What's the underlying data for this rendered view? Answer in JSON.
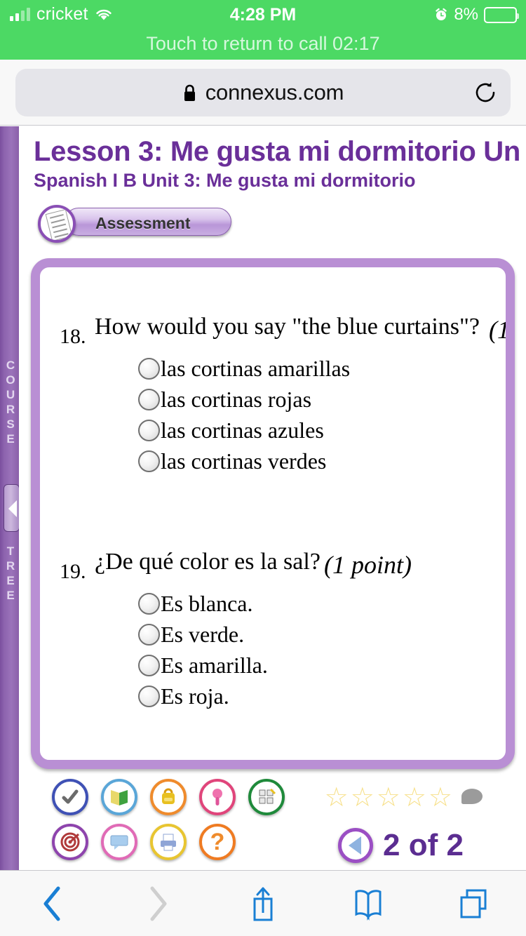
{
  "status_bar": {
    "carrier": "cricket",
    "time": "4:28 PM",
    "battery_percent": "8%",
    "call_banner": "Touch to return to call 02:17",
    "signal_icon": "signal-bars-icon",
    "wifi_icon": "wifi-icon",
    "alarm_icon": "alarm-clock-icon",
    "battery_icon": "battery-icon",
    "colors": {
      "background": "#4CD964",
      "text": "#FFFFFF",
      "banner_text": "#D6F8DE"
    }
  },
  "browser": {
    "url": "connexus.com",
    "lock_icon": "lock-icon",
    "reload_icon": "reload-icon",
    "bottom_toolbar": {
      "back_icon": "back-chevron-icon",
      "forward_icon": "forward-chevron-icon",
      "share_icon": "share-icon",
      "bookmarks_icon": "book-icon",
      "tabs_icon": "tabs-icon"
    }
  },
  "sidebar": {
    "label_top": "COURSE",
    "label_bottom": "TREE",
    "collapse_icon": "collapse-left-arrow-icon"
  },
  "page": {
    "lesson_title": "Lesson 3: Me gusta mi dormitorio Un",
    "lesson_subtitle": "Spanish I B  Unit 3: Me gusta mi dormitorio",
    "badge_label": "Assessment",
    "badge_icon": "document-icon",
    "accent_color": "#6A2F99",
    "card_border_color": "#B98FD4"
  },
  "questions": [
    {
      "number": "18.",
      "text": "How would you say \"the blue curtains\"?",
      "points": "(1",
      "options": [
        "las cortinas amarillas",
        "las cortinas rojas",
        "las cortinas azules",
        "las cortinas verdes"
      ]
    },
    {
      "number": "19.",
      "text": "¿De qué color es la sal?",
      "points": "(1 point)",
      "options": [
        "Es blanca.",
        "Es verde.",
        "Es amarilla.",
        "Es roja."
      ]
    }
  ],
  "tools": {
    "row1": [
      {
        "name": "checkmark-icon",
        "glyph": "✔",
        "ring": "#3f51b5",
        "color": "#6b6b6b"
      },
      {
        "name": "book-icon",
        "glyph": "📗",
        "ring": "#5aa6d8",
        "color": "#2e9b3c"
      },
      {
        "name": "backpack-icon",
        "glyph": "🎒",
        "ring": "#ef8b2c",
        "color": "#e8b020"
      },
      {
        "name": "pushpin-icon",
        "glyph": "📌",
        "ring": "#e0457b",
        "color": "#e85fa0"
      },
      {
        "name": "calculator-icon",
        "glyph": "🧮",
        "ring": "#1f8a3b",
        "color": "#4a4a4a"
      }
    ],
    "row2": [
      {
        "name": "target-icon",
        "glyph": "◎",
        "ring": "#8e44ad",
        "color": "#b03a3a"
      },
      {
        "name": "chat-bubble-icon",
        "glyph": "▭",
        "ring": "#e06bb6",
        "color": "#8fb8e0"
      },
      {
        "name": "printer-icon",
        "glyph": "🖨",
        "ring": "#e8c531",
        "color": "#8fa5d6"
      },
      {
        "name": "help-icon",
        "glyph": "?",
        "ring": "#ef7b22",
        "color": "#ef8b2c"
      }
    ]
  },
  "rating": {
    "stars": [
      "☆",
      "☆",
      "☆",
      "☆",
      "☆"
    ],
    "star_color": "#F7E08A",
    "comment_icon": "speech-bubble-icon"
  },
  "pagination": {
    "previous_icon": "previous-page-arrow-icon",
    "label": "2 of 2"
  }
}
